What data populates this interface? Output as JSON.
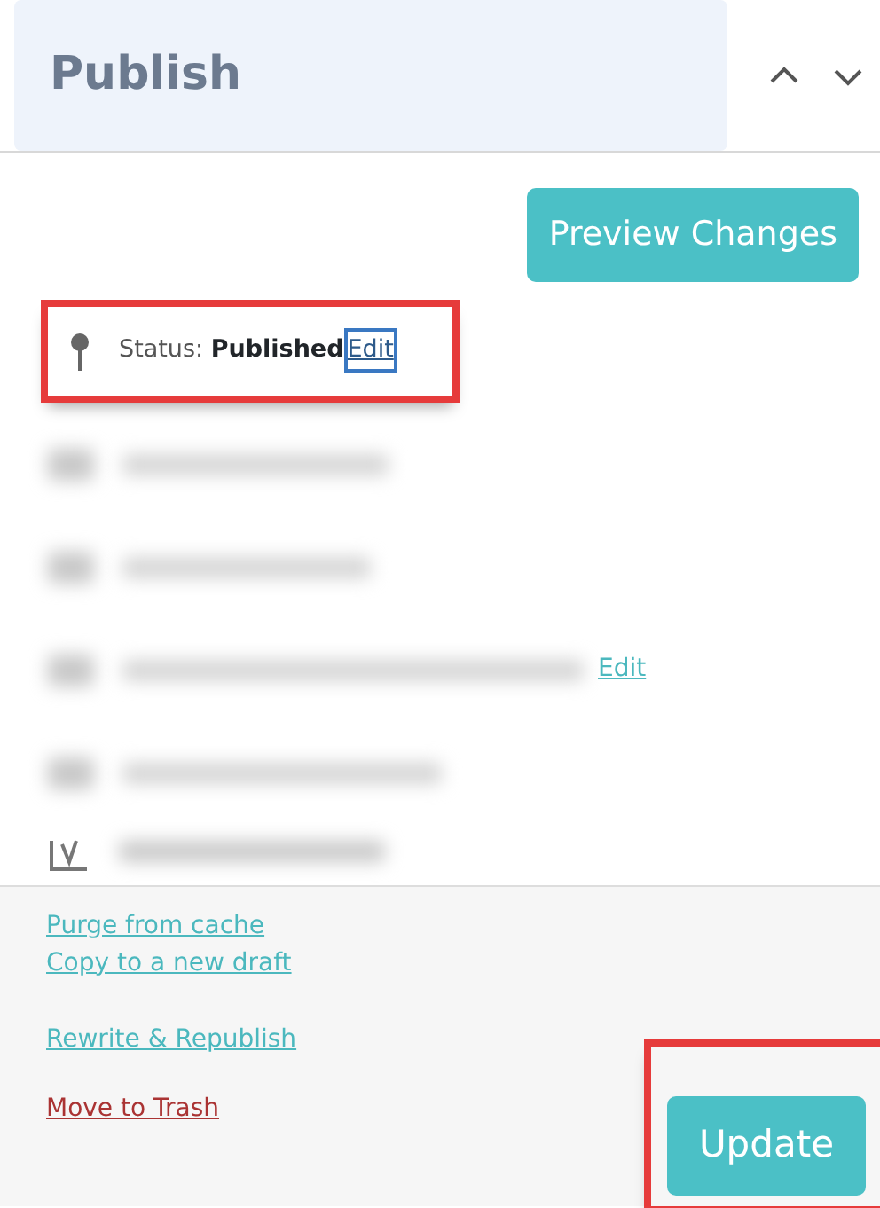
{
  "panel": {
    "title": "Publish",
    "controls": [
      {
        "kind": "up"
      },
      {
        "kind": "down"
      }
    ]
  },
  "preview_button": {
    "label": "Preview Changes"
  },
  "status": {
    "label": "Status:",
    "value": "Published",
    "link": "Edit",
    "highlighted": true,
    "link_focused": true
  },
  "rows": [
    {
      "kind": "redacted"
    },
    {
      "kind": "redacted"
    },
    {
      "kind": "redacted_link",
      "link": "Edit"
    },
    {
      "kind": "redacted"
    },
    {
      "kind": "seo"
    }
  ],
  "actions": [
    {
      "label": "Purge from cache",
      "kind": "link"
    },
    {
      "label": "Copy to a new draft",
      "kind": "link"
    },
    {
      "label": "Rewrite & Republish",
      "kind": "link"
    },
    {
      "label": "Move to Trash",
      "kind": "danger"
    }
  ],
  "update_button": {
    "label": "Update",
    "highlighted": true
  }
}
